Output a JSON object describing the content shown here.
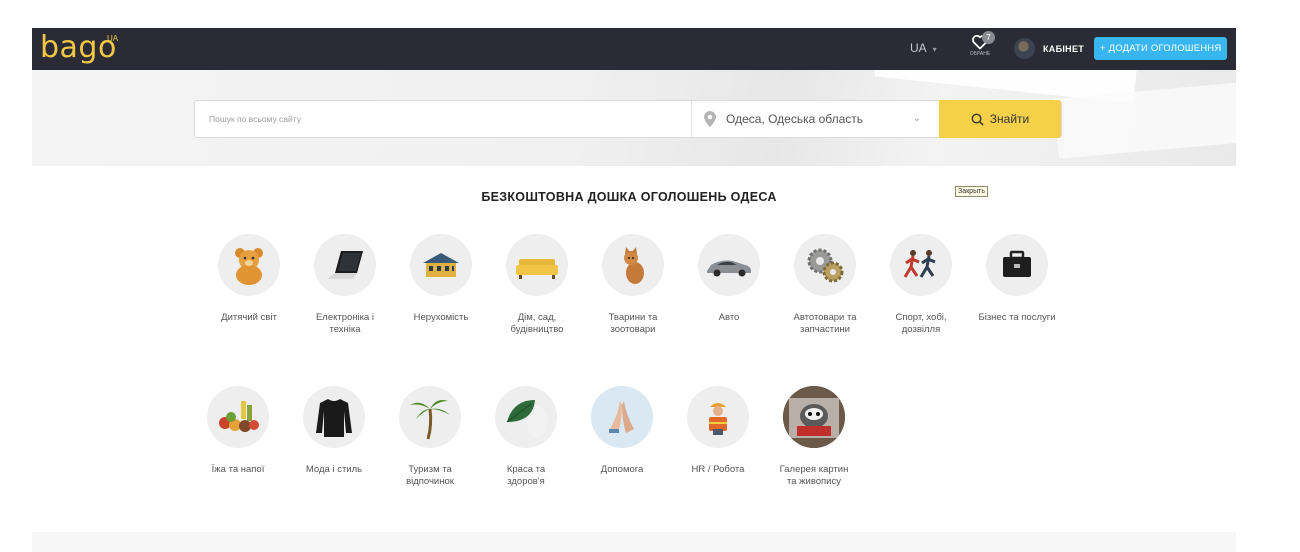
{
  "header": {
    "logo": "bago",
    "logo_sup": "UA",
    "lang": "UA",
    "favorites": {
      "count": "7",
      "label": "ОБРАНЕ"
    },
    "cabinet_label": "КАБІНЕТ",
    "add_button": "+ ДОДАТИ ОГОЛОШЕННЯ"
  },
  "search": {
    "placeholder": "Пошук по всьому сайту",
    "location": "Одеса, Одеська область",
    "button": "Знайти"
  },
  "tooltip": "Закрыть",
  "title": "БЕЗКОШТОВНА ДОШКА ОГОЛОШЕНЬ ОДЕСА",
  "categories": [
    {
      "label": "Дитячий світ",
      "icon": "teddy-bear-icon"
    },
    {
      "label": "Електроніка і техніка",
      "icon": "laptop-icon"
    },
    {
      "label": "Нерухомість",
      "icon": "house-icon"
    },
    {
      "label": "Дім, сад, будівництво",
      "icon": "sofa-icon"
    },
    {
      "label": "Тварини та зоотовари",
      "icon": "cat-icon"
    },
    {
      "label": "Авто",
      "icon": "car-icon"
    },
    {
      "label": "Автотовари та запчастини",
      "icon": "gears-icon"
    },
    {
      "label": "Спорт, хобі, дозвілля",
      "icon": "runners-icon"
    },
    {
      "label": "Бізнес та послуги",
      "icon": "briefcase-icon"
    },
    {
      "label": "Їжа та напої",
      "icon": "food-icon"
    },
    {
      "label": "Мода і стиль",
      "icon": "sweater-icon"
    },
    {
      "label": "Туризм та відпочинок",
      "icon": "palm-tree-icon"
    },
    {
      "label": "Краса та здоров'я",
      "icon": "leaf-icon"
    },
    {
      "label": "Допомога",
      "icon": "praying-hands-icon"
    },
    {
      "label": "HR / Робота",
      "icon": "worker-icon"
    },
    {
      "label": "Галерея картин та живопису",
      "icon": "painting-icon"
    }
  ],
  "colors": {
    "header_bg": "#2b2b35",
    "logo": "#f2c744",
    "add_button": "#38b6f1",
    "search_button": "#f7d04a"
  }
}
